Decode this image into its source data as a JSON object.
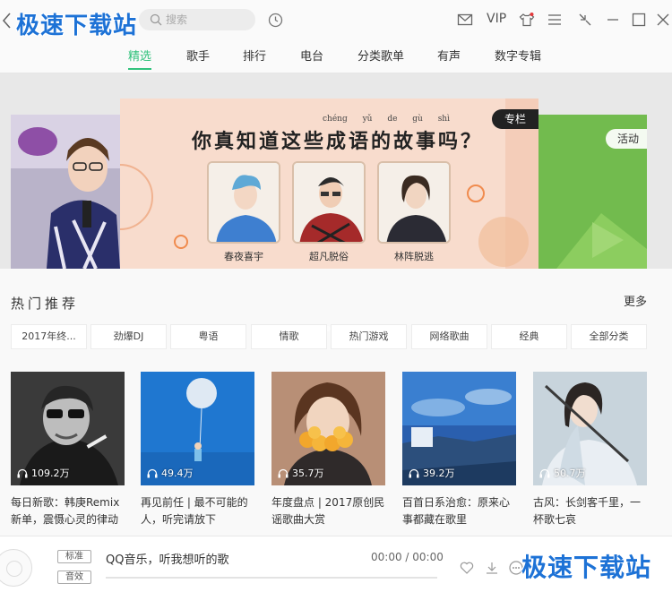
{
  "watermark": "极速下载站",
  "search": {
    "placeholder": "搜索"
  },
  "titlebar": {
    "vip_label": "VIP"
  },
  "tabs": [
    {
      "label": "精选",
      "active": true
    },
    {
      "label": "歌手",
      "active": false
    },
    {
      "label": "排行",
      "active": false
    },
    {
      "label": "电台",
      "active": false
    },
    {
      "label": "分类歌单",
      "active": false
    },
    {
      "label": "有声",
      "active": false
    },
    {
      "label": "数字专辑",
      "active": false
    }
  ],
  "banner": {
    "headline": "你真知道这些成语的故事吗？",
    "pinyin": "chéng yǔ de gù shì",
    "badge_main": "专栏",
    "badge_right": "活动",
    "captions": [
      "春夜喜宇",
      "超凡脱俗",
      "林阵脱逃"
    ]
  },
  "recommend": {
    "title": "热门推荐",
    "more_label": "更多",
    "chips": [
      "2017年终...",
      "劲爆DJ",
      "粤语",
      "情歌",
      "热门游戏",
      "网络歌曲",
      "经典",
      "全部分类"
    ],
    "cards": [
      {
        "plays": "109.2万",
        "title": "每日新歌：韩庚Remix新单，震慑心灵的律动"
      },
      {
        "plays": "49.4万",
        "title": "再见前任 | 最不可能的人，听完请放下"
      },
      {
        "plays": "35.7万",
        "title": "年度盘点 | 2017原创民谣歌曲大赏"
      },
      {
        "plays": "39.2万",
        "title": "百首日系治愈：原来心事都藏在歌里"
      },
      {
        "plays": "50.7万",
        "title": "古风：长剑客千里，一杯歌七哀"
      }
    ]
  },
  "player": {
    "quality_label": "标准",
    "effect_label": "音效",
    "song": "QQ音乐，听我想听的歌",
    "time": "00:00 / 00:00",
    "progress": 0
  },
  "colors": {
    "accent": "#31c27c",
    "watermark": "#1d72d6"
  }
}
